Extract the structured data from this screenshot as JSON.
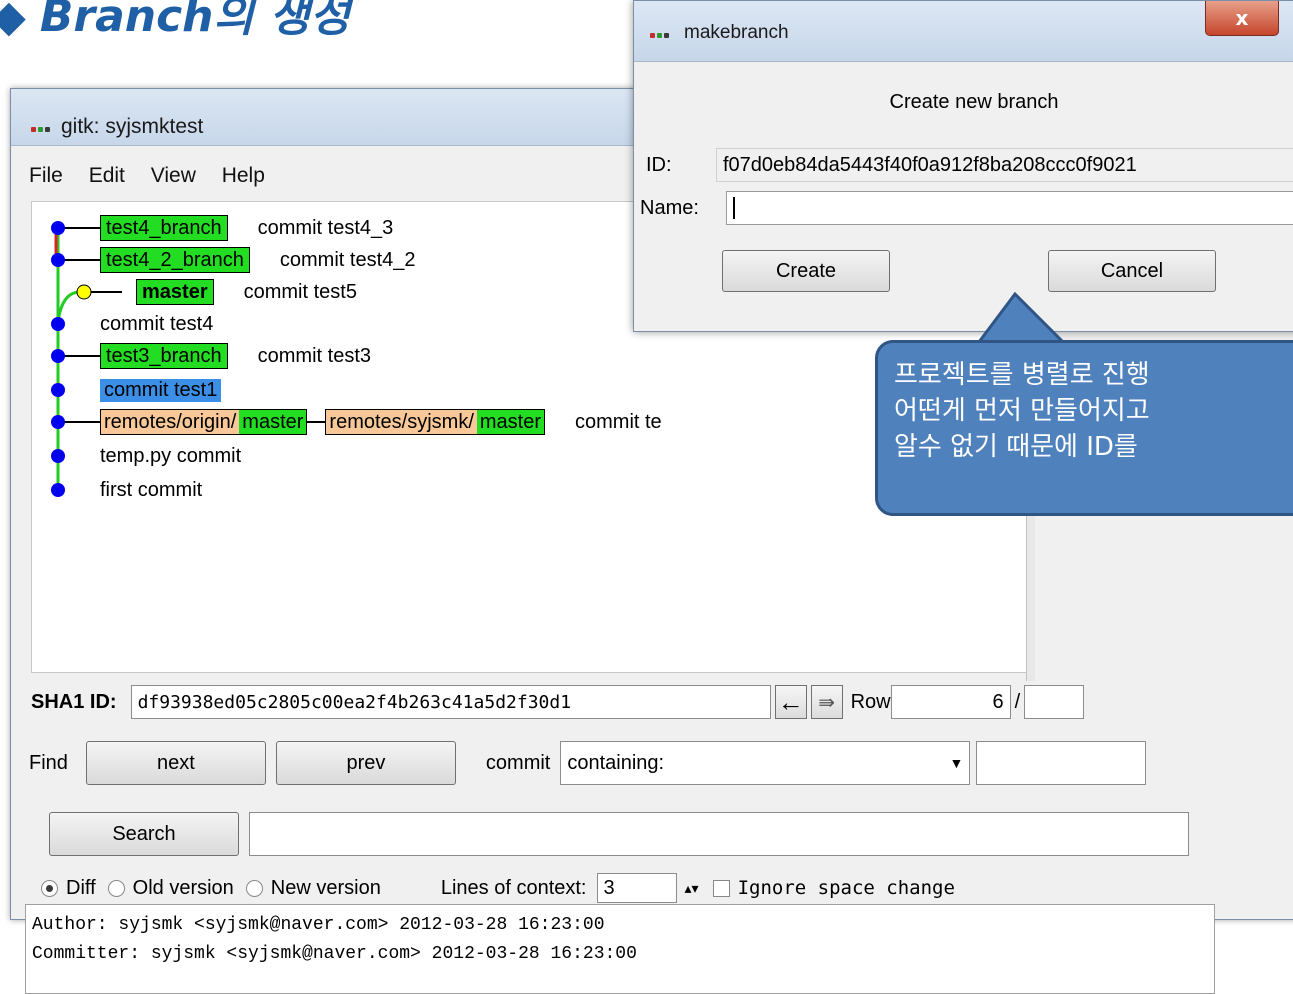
{
  "slide": {
    "title": "Branch의 생성",
    "bullet": "◆"
  },
  "gitk": {
    "title": "gitk: syjsmktest",
    "menu": [
      "File",
      "Edit",
      "View",
      "Help"
    ],
    "commits": [
      {
        "branches": [
          "test4_branch"
        ],
        "message": "commit test4_3"
      },
      {
        "branches": [
          "test4_2_branch"
        ],
        "message": "commit test4_2"
      },
      {
        "branches": [
          "master"
        ],
        "message": "commit test5"
      },
      {
        "branches": [],
        "message": "commit test4"
      },
      {
        "branches": [
          "test3_branch"
        ],
        "message": "commit test3"
      },
      {
        "branches": [],
        "message": "commit test1"
      },
      {
        "remotes": [
          {
            "prefix": "remotes/origin/",
            "branch": "master"
          },
          {
            "prefix": "remotes/syjsmk/",
            "branch": "master"
          }
        ],
        "message": "commit te"
      },
      {
        "branches": [],
        "message": "temp.py commit"
      },
      {
        "branches": [],
        "message": "first commit"
      }
    ],
    "sha1_label": "SHA1 ID:",
    "sha1_value": "df93938ed05c2805c00ea2f4b263c41a5d2f30d1",
    "row_label": "Row",
    "row_value": "6",
    "row_sep": "/",
    "find_label": "Find",
    "next_label": "next",
    "prev_label": "prev",
    "commit_label": "commit",
    "containing_value": "containing:",
    "search_label": "Search",
    "diff_label": "Diff",
    "old_version_label": "Old version",
    "new_version_label": "New version",
    "lines_of_context_label": "Lines of context:",
    "lines_of_context_value": "3",
    "ignore_space_label": "Ignore space change",
    "author_line": "Author: syjsmk <syjsmk@naver.com>  2012-03-28 16:23:00",
    "committer_line": "Committer: syjsmk <syjsmk@naver.com>  2012-03-28 16:23:00"
  },
  "dialog": {
    "title": "makebranch",
    "close_label": "x",
    "heading": "Create new branch",
    "id_label": "ID:",
    "id_value": "f07d0eb84da5443f40f0a912f8ba208ccc0f9021",
    "name_label": "Name:",
    "name_value": "",
    "create_label": "Create",
    "cancel_label": "Cancel"
  },
  "callout": {
    "lines": [
      "프로젝트를 병렬로 진행",
      "어떤게 먼저 만들어지고",
      "알수 없기 때문에 ID를"
    ]
  },
  "colors": {
    "branch_tag": "#22dd22",
    "remote_tag": "#f8c898",
    "selected_row": "#3b8fe6",
    "callout_fill": "#4f81bd",
    "title_color": "#1f5fa6"
  }
}
